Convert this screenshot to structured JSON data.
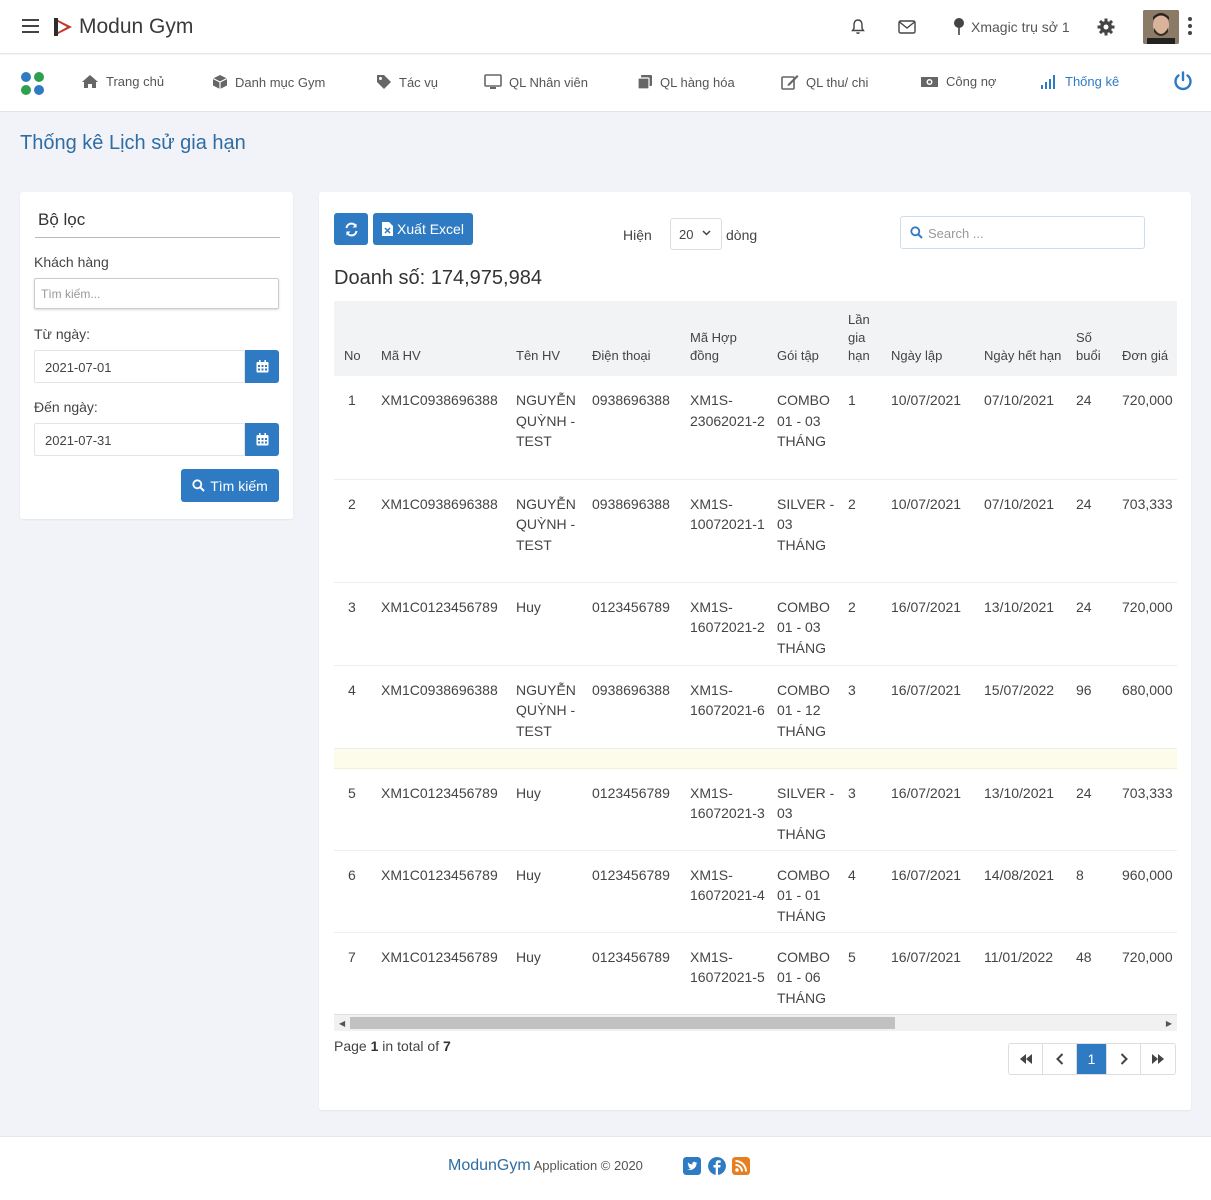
{
  "app": {
    "brand": "Modun Gym",
    "branch": "Xmagic trụ sở 1"
  },
  "topbar": {
    "icons": [
      "menu-icon",
      "bell-icon",
      "envelope-icon",
      "map-pin-icon",
      "gear-icon",
      "more-vertical-icon"
    ]
  },
  "nav": {
    "items": [
      {
        "label": "Trang chủ",
        "icon": "home-icon"
      },
      {
        "label": "Danh mục Gym",
        "icon": "cube-icon"
      },
      {
        "label": "Tác vụ",
        "icon": "tag-icon"
      },
      {
        "label": "QL Nhân viên",
        "icon": "monitor-icon"
      },
      {
        "label": "QL hàng hóa",
        "icon": "copy-icon"
      },
      {
        "label": "QL thu/ chi",
        "icon": "edit-icon"
      },
      {
        "label": "Công nợ",
        "icon": "money-icon"
      },
      {
        "label": "Thống kê",
        "icon": "signal-bars-icon",
        "active": true
      }
    ]
  },
  "page": {
    "title": "Thống kê Lịch sử gia hạn"
  },
  "filter": {
    "title": "Bộ lọc",
    "customer_label": "Khách hàng",
    "customer_placeholder": "Tìm kiếm...",
    "from_label": "Từ ngày:",
    "from_value": "2021-07-01",
    "to_label": "Đến ngày:",
    "to_value": "2021-07-31",
    "search_label": "Tìm kiếm"
  },
  "toolbar": {
    "excel_label": "Xuất Excel",
    "show_label": "Hiện",
    "page_size": "20",
    "rows_label": "dòng",
    "search_placeholder": "Search ..."
  },
  "summary": {
    "revenue_label": "Doanh số: 174,975,984"
  },
  "table": {
    "columns": [
      "No",
      "Mã HV",
      "Tên HV",
      "Điện thoại",
      "Mã Hợp đồng",
      "Gói tập",
      "Lần gia hạn",
      "Ngày lập",
      "Ngày hết hạn",
      "Số buổi",
      "Đơn giá"
    ],
    "rows": [
      [
        "1",
        "XM1C0938696388",
        "NGUYỄN QUỲNH - TEST",
        "0938696388",
        "XM1S-23062021-2",
        "COMBO 01 - 03 THÁNG",
        "1",
        "10/07/2021",
        "07/10/2021",
        "24",
        "720,000"
      ],
      [
        "2",
        "XM1C0938696388",
        "NGUYỄN QUỲNH - TEST",
        "0938696388",
        "XM1S-10072021-1",
        "SILVER - 03 THÁNG",
        "2",
        "10/07/2021",
        "07/10/2021",
        "24",
        "703,333"
      ],
      [
        "3",
        "XM1C0123456789",
        "Huy",
        "0123456789",
        "XM1S-16072021-2",
        "COMBO 01 - 03 THÁNG",
        "2",
        "16/07/2021",
        "13/10/2021",
        "24",
        "720,000"
      ],
      [
        "4",
        "XM1C0938696388",
        "NGUYỄN QUỲNH - TEST",
        "0938696388",
        "XM1S-16072021-6",
        "COMBO 01 - 12 THÁNG",
        "3",
        "16/07/2021",
        "15/07/2022",
        "96",
        "680,000"
      ],
      [
        "5",
        "XM1C0123456789",
        "Huy",
        "0123456789",
        "XM1S-16072021-3",
        "SILVER - 03 THÁNG",
        "3",
        "16/07/2021",
        "13/10/2021",
        "24",
        "703,333"
      ],
      [
        "6",
        "XM1C0123456789",
        "Huy",
        "0123456789",
        "XM1S-16072021-4",
        "COMBO 01 - 01 THÁNG",
        "4",
        "16/07/2021",
        "14/08/2021",
        "8",
        "960,000"
      ],
      [
        "7",
        "XM1C0123456789",
        "Huy",
        "0123456789",
        "XM1S-16072021-5",
        "COMBO 01 - 06 THÁNG",
        "5",
        "16/07/2021",
        "11/01/2022",
        "48",
        "720,000"
      ]
    ]
  },
  "pagination": {
    "page_prefix": "Page ",
    "page": "1",
    "total_prefix": " in total of ",
    "total": "7",
    "current": "1"
  },
  "footer": {
    "brand": "ModunGym",
    "text": " Application © 2020"
  },
  "colors": {
    "primary": "#2e7bc4",
    "title": "#2e6da4"
  }
}
